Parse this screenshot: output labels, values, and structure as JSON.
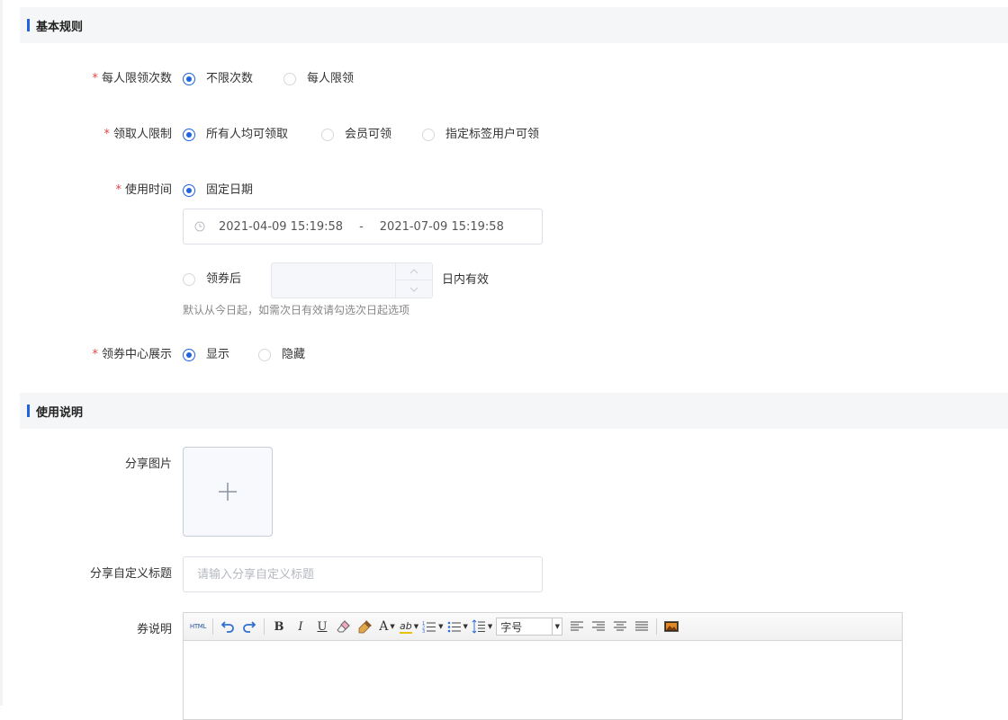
{
  "sections": {
    "basic_rules": "基本规则",
    "usage_notes": "使用说明"
  },
  "limit_per_person": {
    "label": "每人限领次数",
    "required_mark": "*",
    "options": [
      "不限次数",
      "每人限领"
    ],
    "selected": "不限次数"
  },
  "receiver_limit": {
    "label": "领取人限制",
    "required_mark": "*",
    "options": [
      "所有人均可领取",
      "会员可领",
      "指定标签用户可领"
    ],
    "selected": "所有人均可领取"
  },
  "use_time": {
    "label": "使用时间",
    "required_mark": "*",
    "fixed_option": "固定日期",
    "start": "2021-04-09 15:19:58",
    "separator": "-",
    "end": "2021-07-09 15:19:58",
    "after_option": "领券后",
    "days_value": "",
    "suffix": "日内有效",
    "hint": "默认从今日起，如需次日有效请勾选次日起选项"
  },
  "center_display": {
    "label": "领券中心展示",
    "required_mark": "*",
    "options": [
      "显示",
      "隐藏"
    ],
    "selected": "显示"
  },
  "share_image": {
    "label": "分享图片",
    "icon": "plus-icon"
  },
  "share_title": {
    "label": "分享自定义标题",
    "placeholder": "请输入分享自定义标题",
    "value": ""
  },
  "coupon_desc": {
    "label": "券说明",
    "toolbar": {
      "html": "HTML",
      "bold": "B",
      "italic": "I",
      "underline": "U",
      "font_color": "A",
      "highlight": "ab",
      "font_size": "字号"
    }
  },
  "colors": {
    "accent": "#1f63e0",
    "required": "#e54545"
  }
}
